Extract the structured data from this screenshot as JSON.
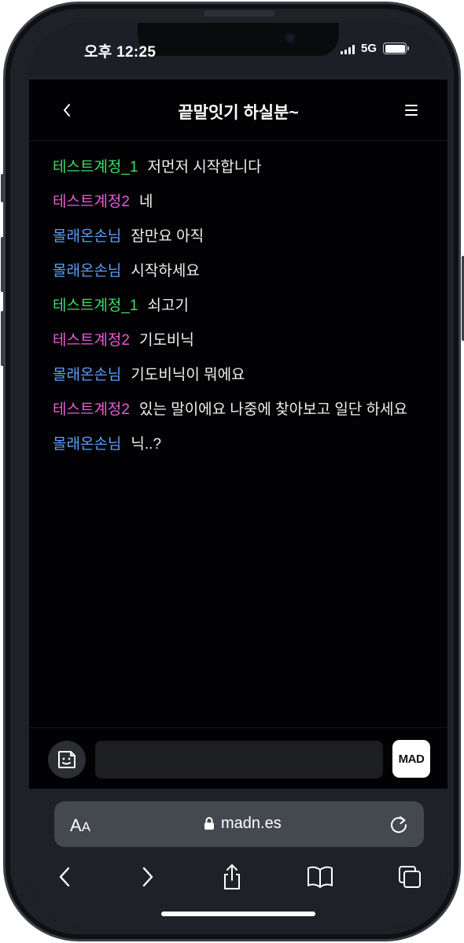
{
  "status_bar": {
    "time": "오후 12:25",
    "network": "5G"
  },
  "chat": {
    "title": "끝말잇기 하실분~",
    "input_placeholder": "",
    "send_label": "MAD",
    "colors": {
      "green": "#3ddc6c",
      "pink": "#e85cd9",
      "blue": "#5a9ff5"
    },
    "messages": [
      {
        "nick": "테스트계정_1",
        "text": "저먼저 시작합니다",
        "color": "#3ddc6c"
      },
      {
        "nick": "테스트계정2",
        "text": "네",
        "color": "#e85cd9"
      },
      {
        "nick": "몰래온손님",
        "text": "잠만요 아직",
        "color": "#5a9ff5"
      },
      {
        "nick": "몰래온손님",
        "text": "시작하세요",
        "color": "#5a9ff5"
      },
      {
        "nick": "테스트계정_1",
        "text": "쇠고기",
        "color": "#3ddc6c"
      },
      {
        "nick": "테스트계정2",
        "text": "기도비닉",
        "color": "#e85cd9"
      },
      {
        "nick": "몰래온손님",
        "text": "기도비닉이 뭐에요",
        "color": "#5a9ff5"
      },
      {
        "nick": "테스트계정2",
        "text": "있는 말이에요 나중에 찾아보고 일단 하세요",
        "color": "#e85cd9"
      },
      {
        "nick": "몰래온손님",
        "text": "닉..?",
        "color": "#5a9ff5"
      }
    ]
  },
  "browser": {
    "text_size_label_big": "A",
    "text_size_label_small": "A",
    "url": "madn.es"
  }
}
